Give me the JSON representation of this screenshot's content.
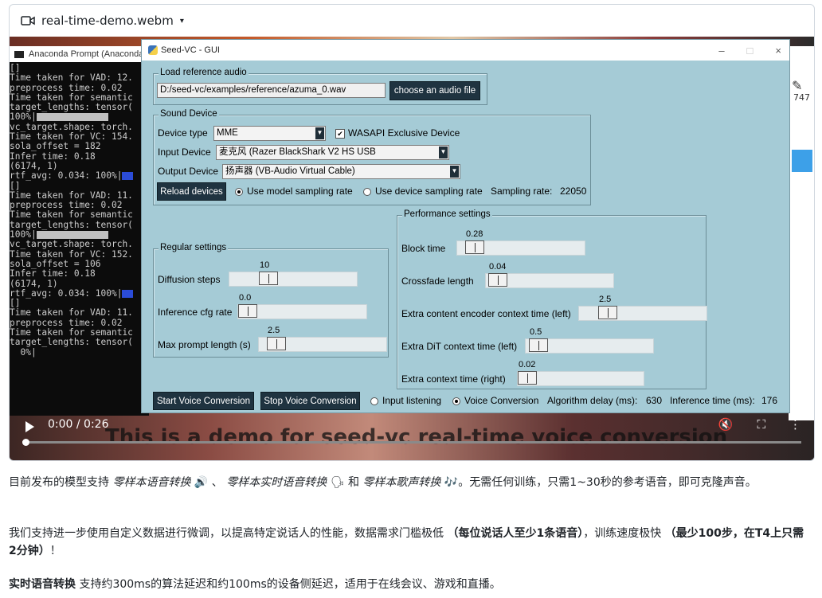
{
  "file_header": {
    "title": "real-time-demo.webm",
    "icon": "video-camera-icon",
    "caret": "▾"
  },
  "console": {
    "title": "Anaconda Prompt (Anaconda",
    "lines": [
      "[]",
      "Time taken for VAD: 12.",
      "preprocess time: 0.02",
      "Time taken for semantic",
      "target_lengths: tensor(",
      "100%|",
      "vc_target.shape: torch.",
      "Time taken for VC: 154.",
      "sola_offset = 182",
      "Infer time: 0.18",
      "(6174, 1)",
      "rtf_avg: 0.034: 100%|",
      "[]",
      "Time taken for VAD: 11.",
      "preprocess time: 0.02",
      "Time taken for semantic",
      "target_lengths: tensor(",
      "100%|",
      "vc_target.shape: torch.",
      "Time taken for VC: 152.",
      "sola_offset = 106",
      "Infer time: 0.18",
      "(6174, 1)",
      "rtf_avg: 0.034: 100%|",
      "[]",
      "Time taken for VAD: 11.",
      "preprocess time: 0.02",
      "Time taken for semantic",
      "target_lengths: tensor(",
      "  0%|"
    ]
  },
  "gui": {
    "title": "Seed-VC - GUI",
    "window_controls": [
      "–",
      "□",
      "×"
    ],
    "reference": {
      "legend": "Load reference audio",
      "path": "D:/seed-vc/examples/reference/azuma_0.wav",
      "choose_label": "choose an audio file"
    },
    "sound_device": {
      "legend": "Sound Device",
      "device_type_label": "Device type",
      "device_type_value": "MME",
      "wasapi_label": "WASAPI Exclusive Device",
      "wasapi_checked": true,
      "input_label": "Input Device",
      "input_value": "麦克风 (Razer BlackShark V2 HS USB",
      "output_label": "Output Device",
      "output_value": "扬声器 (VB-Audio Virtual Cable)",
      "reload_label": "Reload devices",
      "model_rate_label": "Use model sampling rate",
      "device_rate_label": "Use device sampling rate",
      "sampling_rate_label": "Sampling rate:",
      "sampling_rate_value": "22050"
    },
    "regular": {
      "legend": "Regular settings",
      "sliders": [
        {
          "label": "Diffusion steps",
          "value": "10",
          "fraction": 0.27
        },
        {
          "label": "Inference cfg rate",
          "value": "0.0",
          "fraction": 0.0
        },
        {
          "label": "Max prompt length (s)",
          "value": "2.5",
          "fraction": 0.07
        }
      ]
    },
    "performance": {
      "legend": "Performance settings",
      "sliders": [
        {
          "label": "Block time",
          "value": "0.28",
          "fraction": 0.07
        },
        {
          "label": "Crossfade length",
          "value": "0.04",
          "fraction": 0.02
        },
        {
          "label": "Extra content encoder context time (left)",
          "value": "2.5",
          "fraction": 0.18
        },
        {
          "label": "Extra DiT context time (left)",
          "value": "0.5",
          "fraction": 0.03
        },
        {
          "label": "Extra context time (right)",
          "value": "0.02",
          "fraction": 0.0
        }
      ]
    },
    "bottom": {
      "start_label": "Start Voice Conversion",
      "stop_label": "Stop Voice Conversion",
      "input_listen_label": "Input listening",
      "voice_conv_label": "Voice Conversion",
      "algo_delay_label": "Algorithm delay (ms):",
      "algo_delay_value": "630",
      "infer_time_label": "Inference time (ms):",
      "infer_time_value": "176"
    }
  },
  "player": {
    "time": "0:00 / 0:26",
    "progress": 0.0,
    "subtitle": "This is a demo for seed-vc real-time voice conversion"
  },
  "right_snippet": {
    "value": "747"
  },
  "text": {
    "p1_a": "目前发布的模型支持",
    "p1_i1": "零样本语音转换",
    "p1_e1": "🔊",
    "p1_b": "、",
    "p1_i2": "零样本实时语音转换",
    "p1_e2": "🗣",
    "p1_c": "和",
    "p1_i3": "零样本歌声转换",
    "p1_e3": "🎶",
    "p1_d": "。无需任何训练，只需1~30秒的参考语音，即可克隆声音。",
    "p2_a": "我们支持进一步使用自定义数据进行微调，以提高特定说话人的性能，数据需求门槛极低",
    "p2_b1": "（每位说话人至少1条语音）",
    "p2_c": "，训练速度极快",
    "p2_b2": "（最少100步，在T4上只需2分钟）",
    "p2_d": "！",
    "p3_b": "实时语音转换",
    "p3_a": "支持约300ms的算法延迟和约100ms的设备侧延迟，适用于在线会议、游戏和直播。"
  }
}
